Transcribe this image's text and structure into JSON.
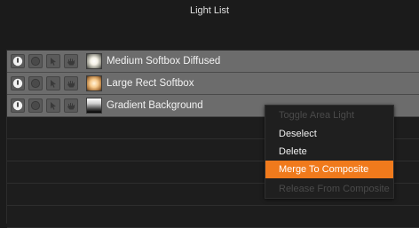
{
  "window": {
    "title": "Light List"
  },
  "lights": [
    {
      "name": "Medium Softbox Diffused",
      "thumbnail": "white-radial-softbox"
    },
    {
      "name": "Large Rect Softbox",
      "thumbnail": "warm-radial-softbox"
    },
    {
      "name": "Gradient Background",
      "thumbnail": "white-to-black-gradient"
    }
  ],
  "row_buttons": [
    {
      "icon": "power-icon"
    },
    {
      "icon": "solo-circle-icon"
    },
    {
      "icon": "cursor-arrow-icon"
    },
    {
      "icon": "hand-icon"
    }
  ],
  "context_menu": {
    "items": [
      {
        "label": "Toggle Area Light",
        "state": "disabled"
      },
      {
        "label": "Deselect",
        "state": "enabled"
      },
      {
        "label": "Delete",
        "state": "enabled"
      },
      {
        "label": "Merge To Composite",
        "state": "highlighted"
      },
      {
        "label": "Release From Composite",
        "state": "disabled"
      }
    ]
  },
  "colors": {
    "background": "#1b1b1b",
    "row_active": "#6c6c6c",
    "menu_highlight": "#f07a1c",
    "menu_disabled_text": "#4a4a4a"
  }
}
